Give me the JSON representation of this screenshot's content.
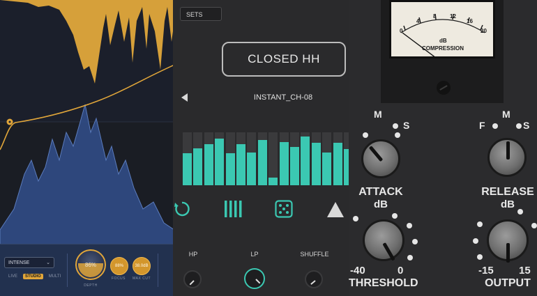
{
  "left_plugin": {
    "mode_select": "INTENSE",
    "tabs": [
      "LIVE",
      "STUDIO",
      "MULTI"
    ],
    "active_tab": "STUDIO",
    "depth": {
      "value": "86%",
      "label": "DEPTH",
      "level": 0.86
    },
    "focus": {
      "value": "88%",
      "label": "FOCUS"
    },
    "max_cut": {
      "value": "38.0dB",
      "label": "MAX CUT"
    },
    "colors": {
      "accent": "#e1a63a",
      "panel": "#22314f",
      "spectrum_blue": "#2f4a82"
    }
  },
  "sampler": {
    "presets_button": "SETS",
    "sample_title": "CLOSED HH",
    "sample_name": "INSTANT_CH-08",
    "step_levels": [
      0.6,
      0.7,
      0.78,
      0.88,
      0.6,
      0.77,
      0.62,
      0.86,
      0.14,
      0.82,
      0.72,
      0.92,
      0.8,
      0.62,
      0.8,
      0.68
    ],
    "controls": [
      "refresh-icon",
      "steps-icon",
      "dice-icon",
      "play-icon"
    ],
    "knobs": [
      {
        "label": "HP"
      },
      {
        "label": "LP"
      },
      {
        "label": "SHUFFLE"
      }
    ],
    "colors": {
      "accent": "#3bc8b2"
    }
  },
  "compressor": {
    "meter_scale": [
      "0",
      "4",
      "8",
      "12",
      "16",
      "20"
    ],
    "meter_unit": "dB",
    "meter_label": "COMPRESSION",
    "attack": {
      "label": "ATTACK",
      "unit": "dB",
      "letters": [
        "M",
        "S"
      ]
    },
    "release": {
      "label": "RELEASE",
      "unit": "dB",
      "letters": [
        "F",
        "M",
        "S"
      ]
    },
    "threshold": {
      "label": "THRESHOLD",
      "min": "-40",
      "max": "0"
    },
    "output": {
      "label": "OUTPUT",
      "min": "-15",
      "max": "15"
    }
  }
}
